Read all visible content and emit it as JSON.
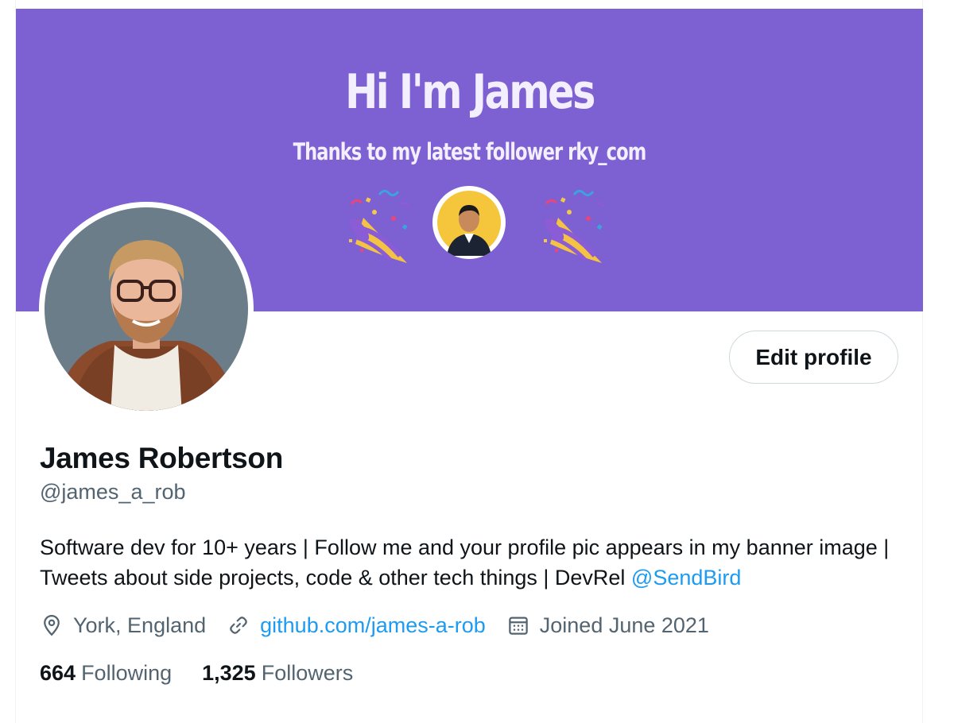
{
  "banner": {
    "title": "Hi I'm James",
    "subtitle": "Thanks to my latest follower rky_com",
    "background_color": "#7d60d1"
  },
  "profile": {
    "edit_button_label": "Edit profile",
    "display_name": "James Robertson",
    "handle": "@james_a_rob",
    "bio_text": "Software dev for 10+ years | Follow me and your profile pic appears in my banner image | Tweets about side projects, code & other tech things | DevRel ",
    "bio_mention": "@SendBird",
    "location": "York, England",
    "website": "github.com/james-a-rob",
    "joined": "Joined June 2021",
    "following_count": "664",
    "following_label": "Following",
    "followers_count": "1,325",
    "followers_label": "Followers"
  },
  "icons": {
    "location": "location-pin-icon",
    "link": "link-icon",
    "calendar": "calendar-icon",
    "banner_decoration": "party-popper-icon"
  },
  "colors": {
    "accent_link": "#1d9bf0",
    "text_primary": "#0f1419",
    "text_secondary": "#536471",
    "button_border": "#cfd9de"
  }
}
